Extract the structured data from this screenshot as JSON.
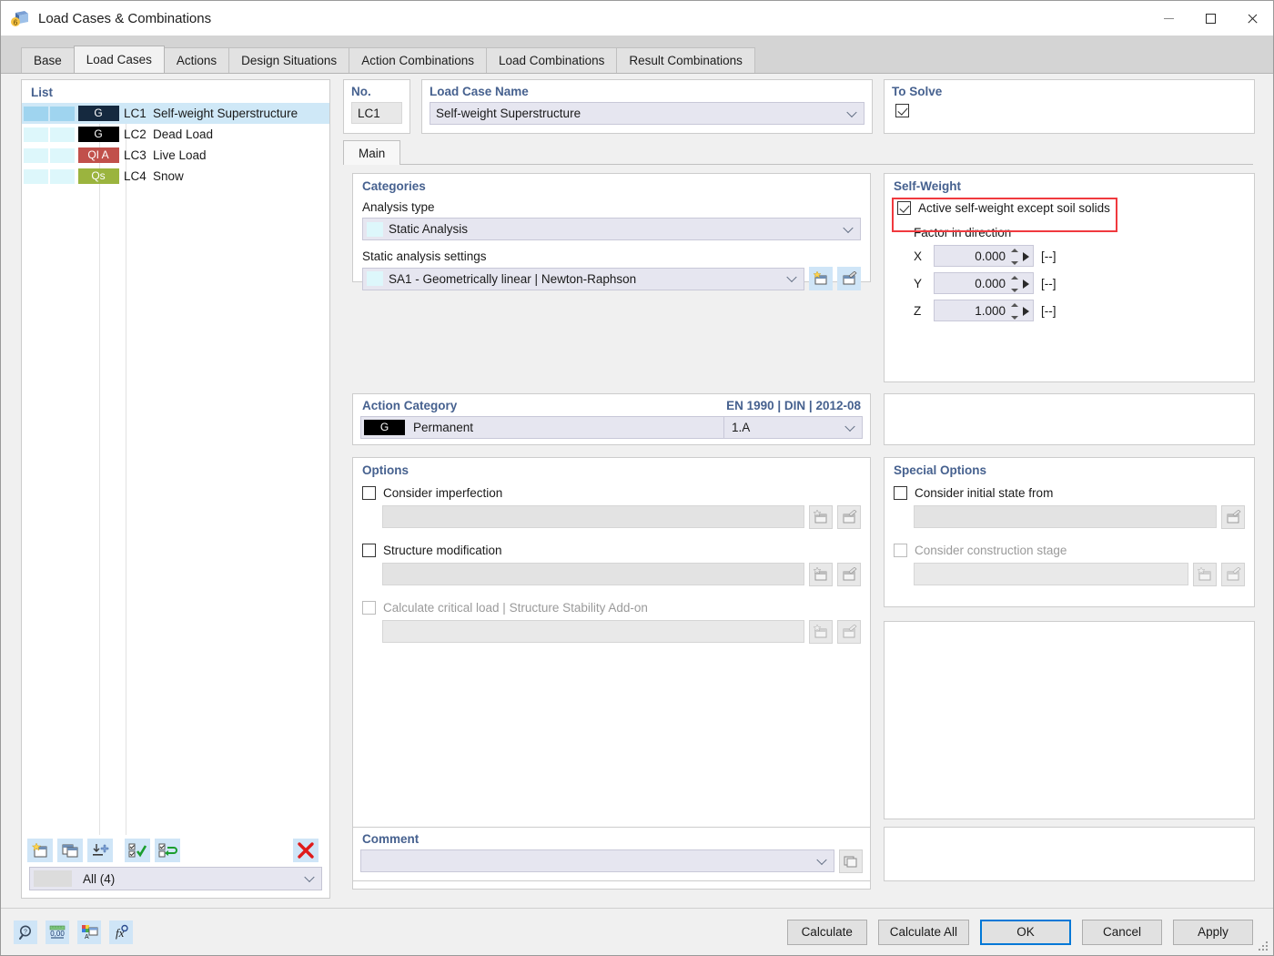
{
  "window": {
    "title": "Load Cases & Combinations",
    "icon": "app-cube-icon",
    "controls": {
      "minimize": "Minimize",
      "maximize": "Maximize",
      "close": "Close"
    }
  },
  "tabs": [
    {
      "label": "Base",
      "active": false
    },
    {
      "label": "Load Cases",
      "active": true
    },
    {
      "label": "Actions",
      "active": false
    },
    {
      "label": "Design Situations",
      "active": false
    },
    {
      "label": "Action Combinations",
      "active": false
    },
    {
      "label": "Load Combinations",
      "active": false
    },
    {
      "label": "Result Combinations",
      "active": false
    }
  ],
  "list": {
    "title": "List",
    "rows": [
      {
        "tag": "G",
        "tag_bg": "#15293f",
        "no": "LC1",
        "name": "Self-weight Superstructure",
        "selected": true
      },
      {
        "tag": "G",
        "tag_bg": "#000000",
        "no": "LC2",
        "name": "Dead Load",
        "selected": false
      },
      {
        "tag": "QI A",
        "tag_bg": "#c1504b",
        "no": "LC3",
        "name": "Live Load",
        "selected": false
      },
      {
        "tag": "Qs",
        "tag_bg": "#9bb council",
        "no": "LC4",
        "name": "Snow",
        "selected": false
      }
    ],
    "toolbar": [
      {
        "name": "new-load-case-button"
      },
      {
        "name": "copy-load-case-button"
      },
      {
        "name": "insert-load-case-button"
      },
      {
        "name": "select-all-button"
      },
      {
        "name": "invert-selection-button"
      },
      {
        "name": "delete-load-case-button"
      }
    ],
    "filter": {
      "value": "All (4)"
    }
  },
  "no_field": {
    "label": "No.",
    "value": "LC1"
  },
  "name_field": {
    "label": "Load Case Name",
    "value": "Self-weight Superstructure"
  },
  "to_solve": {
    "label": "To Solve",
    "checked": true
  },
  "main_tab": {
    "label": "Main"
  },
  "categories": {
    "title": "Categories",
    "analysis_type_label": "Analysis type",
    "analysis_type_value": "Static Analysis",
    "static_settings_label": "Static analysis settings",
    "static_settings_value": "SA1 - Geometrically linear | Newton-Raphson",
    "new_button": "new-settings-button",
    "edit_button": "edit-settings-button"
  },
  "self_weight": {
    "title": "Self-Weight",
    "active_label": "Active self-weight except soil solids",
    "active_checked": true,
    "highlight_color": "#f0393e",
    "factor_label": "Factor in direction",
    "factors": [
      {
        "axis": "X",
        "value": "0.000",
        "unit": "[--]"
      },
      {
        "axis": "Y",
        "value": "0.000",
        "unit": "[--]"
      },
      {
        "axis": "Z",
        "value": "1.000",
        "unit": "[--]"
      }
    ]
  },
  "action_category": {
    "title": "Action Category",
    "standard": "EN 1990 | DIN | 2012-08",
    "tag": "G",
    "value": "Permanent",
    "sub_value": "1.A"
  },
  "options": {
    "title": "Options",
    "items": [
      {
        "label": "Consider imperfection",
        "checked": false,
        "disabled": false,
        "value": "",
        "buttons": 2
      },
      {
        "label": "Structure modification",
        "checked": false,
        "disabled": false,
        "value": "",
        "buttons": 2
      },
      {
        "label": "Calculate critical load | Structure Stability Add-on",
        "checked": false,
        "disabled": true,
        "value": "",
        "buttons": 2
      }
    ]
  },
  "special_options": {
    "title": "Special Options",
    "items": [
      {
        "label": "Consider initial state from",
        "checked": false,
        "disabled": false,
        "value": "",
        "buttons": 1
      },
      {
        "label": "Consider construction stage",
        "checked": false,
        "disabled": true,
        "value": "",
        "buttons": 2
      }
    ]
  },
  "comment": {
    "title": "Comment",
    "value": ""
  },
  "footer": {
    "tools": [
      {
        "name": "help-button"
      },
      {
        "name": "units-button"
      },
      {
        "name": "display-properties-button"
      },
      {
        "name": "formula-button"
      }
    ],
    "buttons": [
      {
        "label": "Calculate",
        "primary": false
      },
      {
        "label": "Calculate All",
        "primary": false
      },
      {
        "label": "OK",
        "primary": true
      },
      {
        "label": "Cancel",
        "primary": false
      },
      {
        "label": "Apply",
        "primary": false
      }
    ]
  }
}
